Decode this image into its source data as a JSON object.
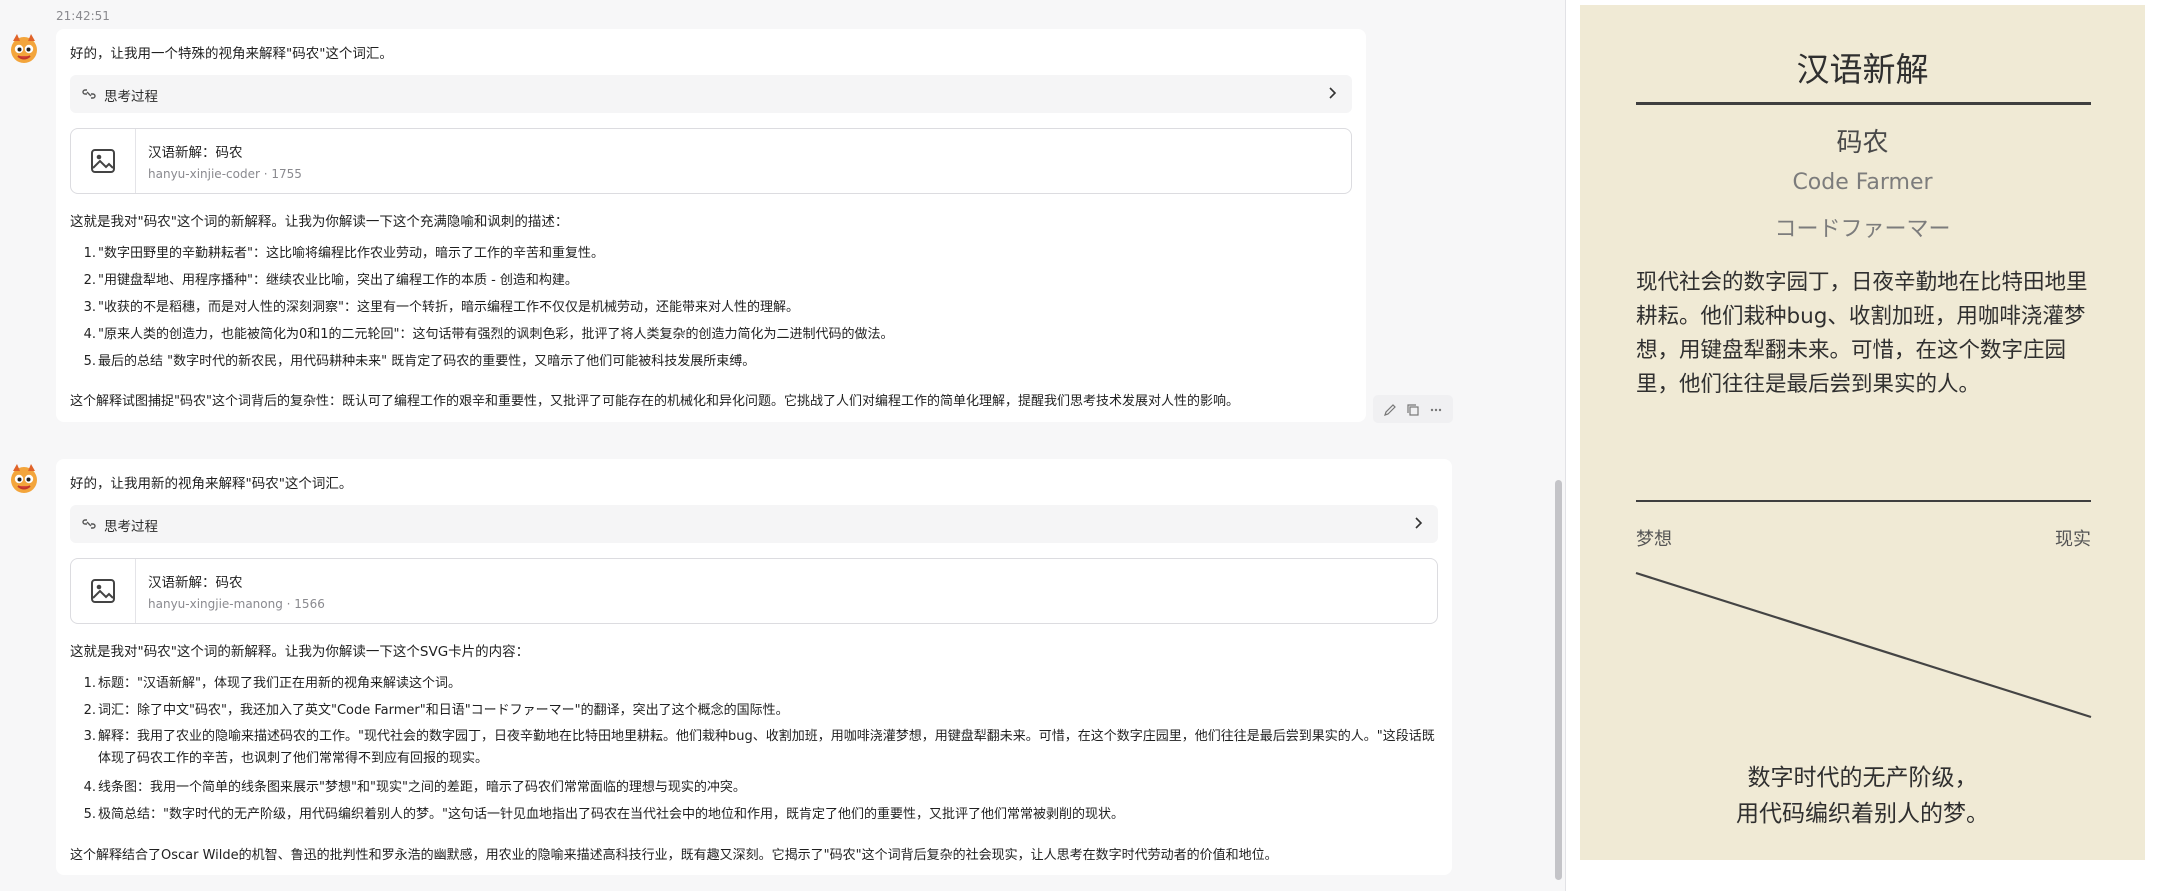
{
  "conversation": {
    "timestamp": "21:42:51",
    "messages": [
      {
        "intro": "好的，让我用一个特殊的视角来解释\"码农\"这个词汇。",
        "thinking_label": "思考过程",
        "artifact": {
          "title": "汉语新解：码农",
          "meta": "hanyu-xinjie-coder · 1755"
        },
        "lead": "这就是我对\"码农\"这个词的新解释。让我为你解读一下这个充满隐喻和讽刺的描述：",
        "points": [
          "\"数字田野里的辛勤耕耘者\"：这比喻将编程比作农业劳动，暗示了工作的辛苦和重复性。",
          "\"用键盘犁地、用程序播种\"：继续农业比喻，突出了编程工作的本质 - 创造和构建。",
          "\"收获的不是稻穗，而是对人性的深刻洞察\"：这里有一个转折，暗示编程工作不仅仅是机械劳动，还能带来对人性的理解。",
          "\"原来人类的创造力，也能被简化为0和1的二元轮回\"：这句话带有强烈的讽刺色彩，批评了将人类复杂的创造力简化为二进制代码的做法。",
          "最后的总结 \"数字时代的新农民，用代码耕种未来\" 既肯定了码农的重要性，又暗示了他们可能被科技发展所束缚。"
        ],
        "closing": "这个解释试图捕捉\"码农\"这个词背后的复杂性：既认可了编程工作的艰辛和重要性，又批评了可能存在的机械化和异化问题。它挑战了人们对编程工作的简单化理解，提醒我们思考技术发展对人性的影响。"
      },
      {
        "intro": "好的，让我用新的视角来解释\"码农\"这个词汇。",
        "thinking_label": "思考过程",
        "artifact": {
          "title": "汉语新解：码农",
          "meta": "hanyu-xingjie-manong · 1566"
        },
        "lead": "这就是我对\"码农\"这个词的新解释。让我为你解读一下这个SVG卡片的内容：",
        "points": [
          "标题：\"汉语新解\"，体现了我们正在用新的视角来解读这个词。",
          "词汇：除了中文\"码农\"，我还加入了英文\"Code Farmer\"和日语\"コードファーマー\"的翻译，突出了这个概念的国际性。",
          "解释：我用了农业的隐喻来描述码农的工作。\"现代社会的数字园丁，日夜辛勤地在比特田地里耕耘。他们栽种bug、收割加班，用咖啡浇灌梦想，用键盘犁翻未来。可惜，在这个数字庄园里，他们往往是最后尝到果实的人。\"这段话既体现了码农工作的辛苦，也讽刺了他们常常得不到应有回报的现实。",
          "线条图：我用一个简单的线条图来展示\"梦想\"和\"现实\"之间的差距，暗示了码农们常常面临的理想与现实的冲突。",
          "极简总结：\"数字时代的无产阶级，用代码编织着别人的梦。\"这句话一针见血地指出了码农在当代社会中的地位和作用，既肯定了他们的重要性，又批评了他们常常被剥削的现状。"
        ],
        "closing": "这个解释结合了Oscar Wilde的机智、鲁迅的批判性和罗永浩的幽默感，用农业的隐喻来描述高科技行业，既有趣又深刻。它揭示了\"码农\"这个词背后复杂的社会现实，让人思考在数字时代劳动者的价值和地位。"
      }
    ],
    "icons": {
      "avatar": "cartoon-avatar-icon",
      "thinking": "link-icon",
      "chevron": "chevron-right-icon",
      "artifact": "image-icon",
      "actions": [
        "edit-icon",
        "copy-icon",
        "more-icon"
      ]
    }
  },
  "preview_card": {
    "title": "汉语新解",
    "word": "码农",
    "english": "Code Farmer",
    "japanese": "コードファーマー",
    "definition": "现代社会的数字园丁，日夜辛勤地在比特田地里耕耘。他们栽种bug、收割加班，用咖啡浇灌梦想，用键盘犁翻未来。可惜，在这个数字庄园里，他们往往是最后尝到果实的人。",
    "left_label": "梦想",
    "right_label": "现实",
    "summary_line1": "数字时代的无产阶级，",
    "summary_line2": "用代码编织着别人的梦。",
    "background_color": "#f0ead5"
  }
}
